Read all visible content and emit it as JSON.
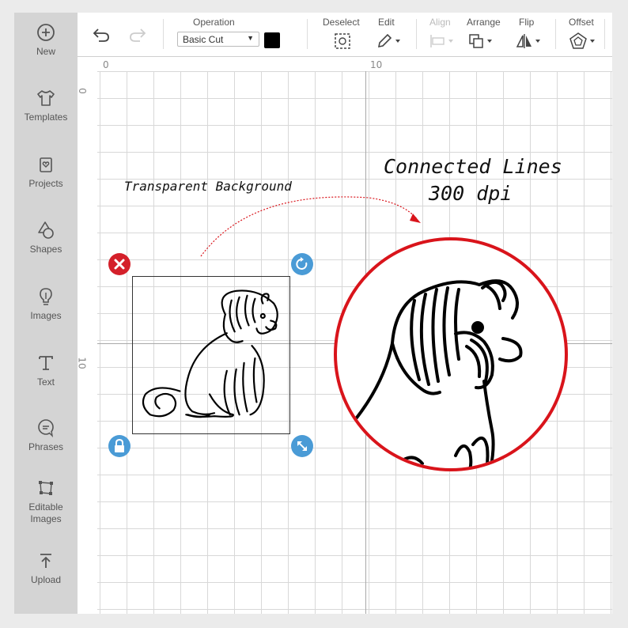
{
  "sidebar": {
    "items": [
      {
        "label": "New",
        "icon": "plus-circle-icon"
      },
      {
        "label": "Templates",
        "icon": "shirt-icon"
      },
      {
        "label": "Projects",
        "icon": "heart-clipboard-icon"
      },
      {
        "label": "Shapes",
        "icon": "shapes-icon"
      },
      {
        "label": "Images",
        "icon": "lightbulb-icon"
      },
      {
        "label": "Text",
        "icon": "text-t-icon"
      },
      {
        "label": "Phrases",
        "icon": "speech-bubble-icon"
      },
      {
        "label": "Editable\nImages",
        "icon": "editable-image-icon"
      },
      {
        "label": "Upload",
        "icon": "upload-icon"
      }
    ]
  },
  "toolbar": {
    "operation_label": "Operation",
    "operation_value": "Basic Cut",
    "deselect_label": "Deselect",
    "edit_label": "Edit",
    "align_label": "Align",
    "arrange_label": "Arrange",
    "flip_label": "Flip",
    "offset_label": "Offset",
    "swatch_color": "#000000"
  },
  "rulers": {
    "h_zero": "0",
    "h_ten": "10",
    "v_zero": "0",
    "v_ten": "10"
  },
  "canvas": {
    "transparent_label": "Transparent Background",
    "connected_label": "Connected Lines",
    "dpi_label": "300 dpi",
    "accent_red": "#d9141b",
    "handle_blue": "#4a9bd6",
    "handle_red": "#d4202a"
  }
}
